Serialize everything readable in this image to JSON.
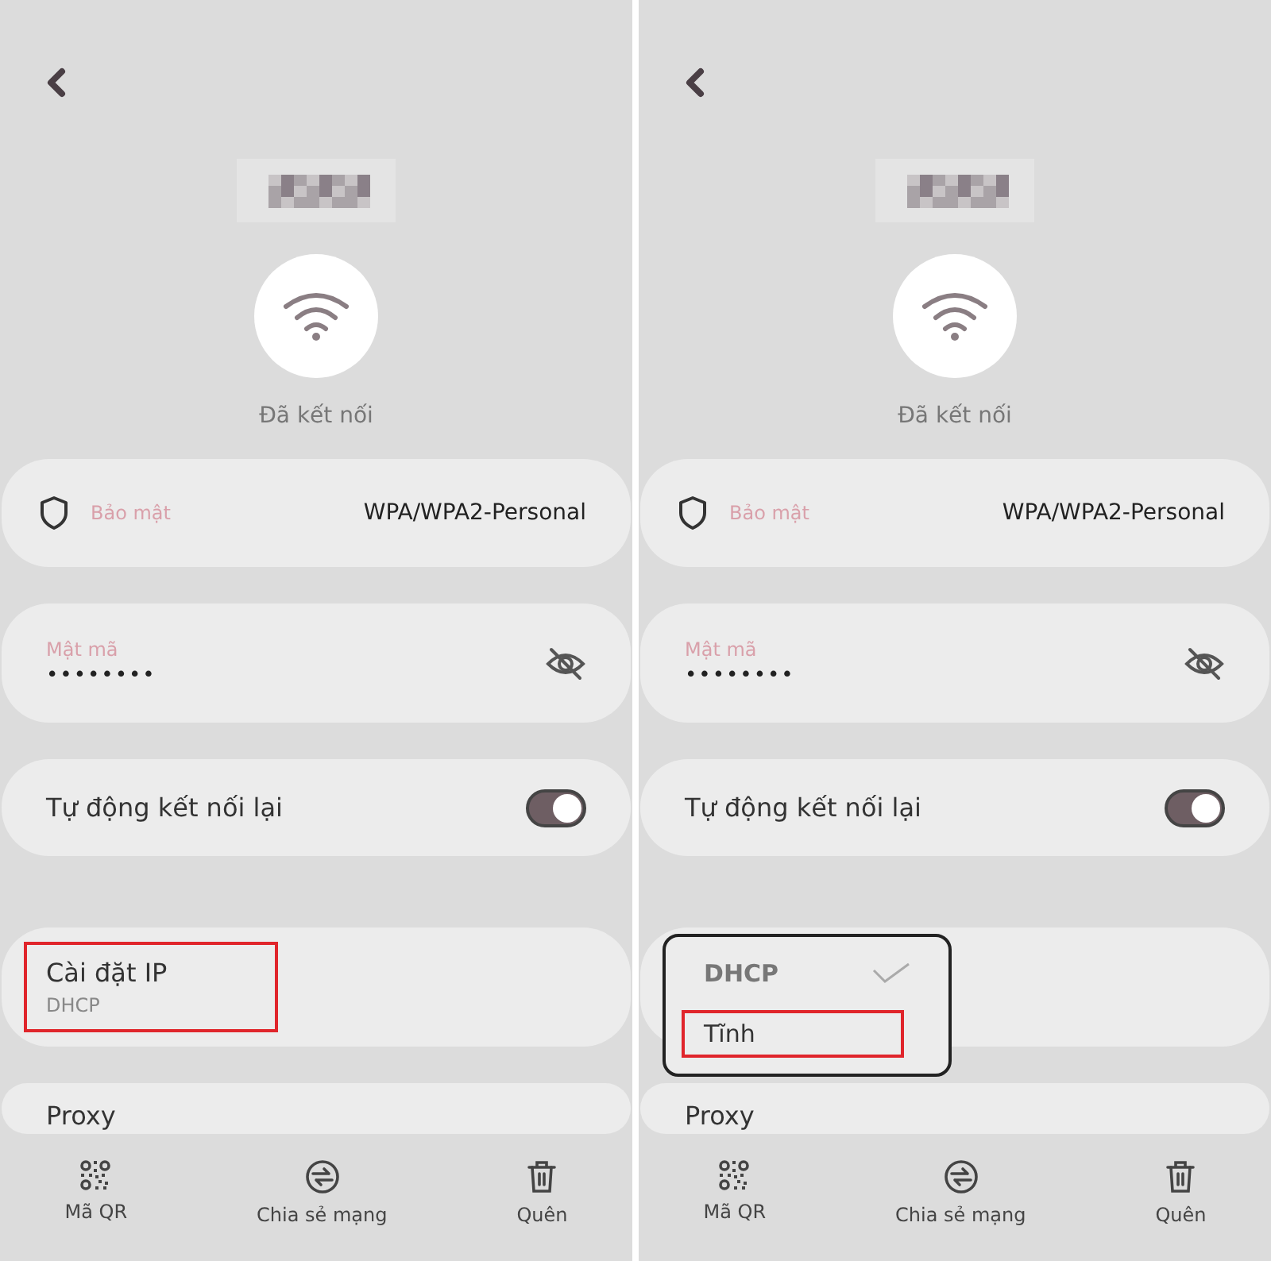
{
  "screens": [
    {
      "status": "Đã kết nối",
      "security": {
        "label": "Bảo mật",
        "value": "WPA/WPA2-Personal"
      },
      "password": {
        "label": "Mật mã",
        "value": "••••••••"
      },
      "auto_reconnect": {
        "label": "Tự động kết nối lại",
        "on": true
      },
      "ip_settings": {
        "title": "Cài đặt IP",
        "value": "DHCP",
        "annotated": true
      },
      "proxy": {
        "label": "Proxy"
      },
      "bottom_actions": [
        {
          "kind": "qr",
          "label": "Mã QR"
        },
        {
          "kind": "share",
          "label": "Chia sẻ mạng"
        },
        {
          "kind": "delete",
          "label": "Quên"
        }
      ]
    },
    {
      "status": "Đã kết nối",
      "security": {
        "label": "Bảo mật",
        "value": "WPA/WPA2-Personal"
      },
      "password": {
        "label": "Mật mã",
        "value": "••••••••"
      },
      "auto_reconnect": {
        "label": "Tự động kết nối lại",
        "on": true
      },
      "ip_dropdown": {
        "options": [
          {
            "label": "DHCP",
            "selected": true,
            "annotated": false
          },
          {
            "label": "Tĩnh",
            "selected": false,
            "annotated": true
          }
        ]
      },
      "proxy": {
        "label": "Proxy"
      },
      "bottom_actions": [
        {
          "kind": "qr",
          "label": "Mã QR"
        },
        {
          "kind": "share",
          "label": "Chia sẻ mạng"
        },
        {
          "kind": "delete",
          "label": "Quên"
        }
      ]
    }
  ]
}
